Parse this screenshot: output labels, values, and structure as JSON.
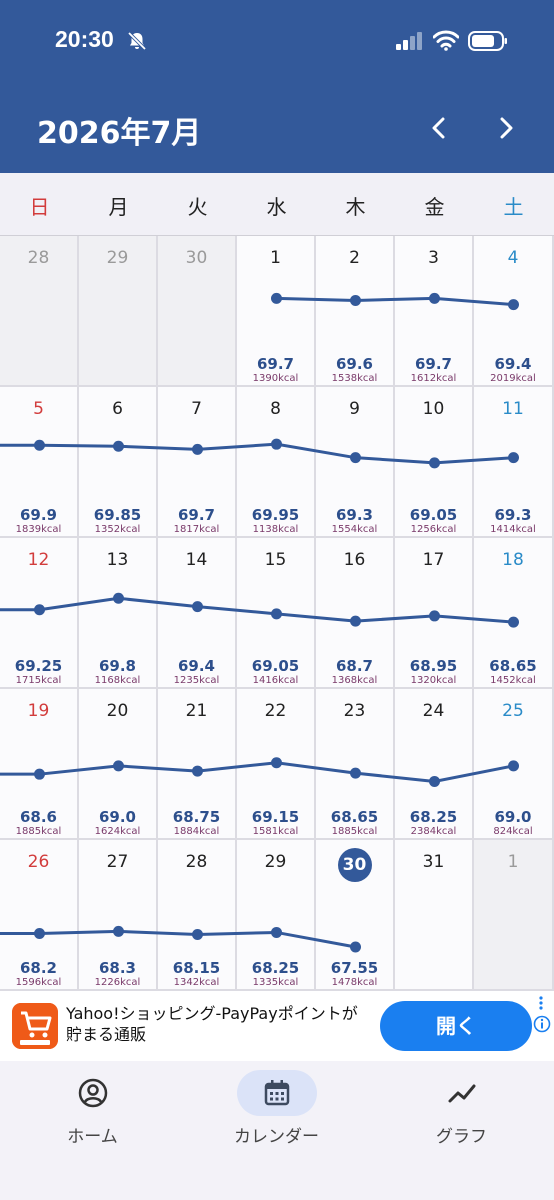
{
  "status_bar": {
    "time": "20:30"
  },
  "header": {
    "month_title": "2026年7月"
  },
  "weekdays": [
    "日",
    "月",
    "火",
    "水",
    "木",
    "金",
    "土"
  ],
  "days": [
    {
      "day": "28",
      "out": true
    },
    {
      "day": "29",
      "out": true
    },
    {
      "day": "30",
      "out": true
    },
    {
      "day": "1",
      "weight": "69.7",
      "kcal": "1390kcal"
    },
    {
      "day": "2",
      "weight": "69.6",
      "kcal": "1538kcal"
    },
    {
      "day": "3",
      "weight": "69.7",
      "kcal": "1612kcal"
    },
    {
      "day": "4",
      "weight": "69.4",
      "kcal": "2019kcal"
    },
    {
      "day": "5",
      "weight": "69.9",
      "kcal": "1839kcal"
    },
    {
      "day": "6",
      "weight": "69.85",
      "kcal": "1352kcal"
    },
    {
      "day": "7",
      "weight": "69.7",
      "kcal": "1817kcal"
    },
    {
      "day": "8",
      "weight": "69.95",
      "kcal": "1138kcal"
    },
    {
      "day": "9",
      "weight": "69.3",
      "kcal": "1554kcal"
    },
    {
      "day": "10",
      "weight": "69.05",
      "kcal": "1256kcal"
    },
    {
      "day": "11",
      "weight": "69.3",
      "kcal": "1414kcal"
    },
    {
      "day": "12",
      "weight": "69.25",
      "kcal": "1715kcal"
    },
    {
      "day": "13",
      "weight": "69.8",
      "kcal": "1168kcal"
    },
    {
      "day": "14",
      "weight": "69.4",
      "kcal": "1235kcal"
    },
    {
      "day": "15",
      "weight": "69.05",
      "kcal": "1416kcal"
    },
    {
      "day": "16",
      "weight": "68.7",
      "kcal": "1368kcal"
    },
    {
      "day": "17",
      "weight": "68.95",
      "kcal": "1320kcal"
    },
    {
      "day": "18",
      "weight": "68.65",
      "kcal": "1452kcal"
    },
    {
      "day": "19",
      "weight": "68.6",
      "kcal": "1885kcal"
    },
    {
      "day": "20",
      "weight": "69.0",
      "kcal": "1624kcal"
    },
    {
      "day": "21",
      "weight": "68.75",
      "kcal": "1884kcal"
    },
    {
      "day": "22",
      "weight": "69.15",
      "kcal": "1581kcal"
    },
    {
      "day": "23",
      "weight": "68.65",
      "kcal": "1885kcal"
    },
    {
      "day": "24",
      "weight": "68.25",
      "kcal": "2384kcal"
    },
    {
      "day": "25",
      "weight": "69.0",
      "kcal": "824kcal"
    },
    {
      "day": "26",
      "weight": "68.2",
      "kcal": "1596kcal"
    },
    {
      "day": "27",
      "weight": "68.3",
      "kcal": "1226kcal"
    },
    {
      "day": "28",
      "weight": "68.15",
      "kcal": "1342kcal"
    },
    {
      "day": "29",
      "weight": "68.25",
      "kcal": "1335kcal"
    },
    {
      "day": "30",
      "weight": "67.55",
      "kcal": "1478kcal",
      "today": true
    },
    {
      "day": "31"
    },
    {
      "day": "1",
      "out": true
    }
  ],
  "ad": {
    "text": "Yahoo!ショッピング-PayPayポイントが貯まる通販",
    "button_label": "開く",
    "logo_icon": "yahoo-shopping-cart-icon"
  },
  "tabs": [
    {
      "label": "ホーム",
      "icon": "person-circle-icon"
    },
    {
      "label": "カレンダー",
      "icon": "calendar-icon",
      "active": true
    },
    {
      "label": "グラフ",
      "icon": "trend-line-icon"
    }
  ],
  "colors": {
    "header": "#33599a",
    "sunday": "#d23c3c",
    "saturday": "#2a8bc8",
    "weight_text": "#2d4f8c",
    "kcal_text": "#7a3a6a",
    "ad_button": "#1a7ff0"
  }
}
